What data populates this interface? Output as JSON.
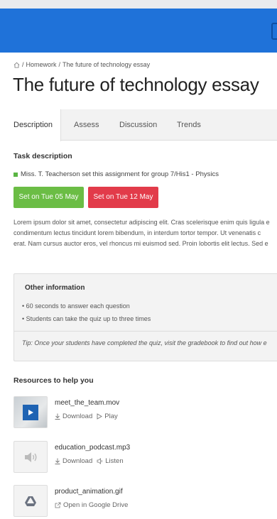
{
  "breadcrumb": {
    "separator": "/",
    "items": [
      "Homework",
      "The future of technology essay"
    ]
  },
  "page": {
    "title": "The future of technology essay"
  },
  "tabs": [
    {
      "label": "Description",
      "active": true
    },
    {
      "label": "Assess",
      "active": false
    },
    {
      "label": "Discussion",
      "active": false
    },
    {
      "label": "Trends",
      "active": false
    }
  ],
  "task": {
    "heading": "Task description",
    "assigned_text": "Miss. T. Teacherson set this assignment for group 7/His1 - Physics",
    "set_label": "Set on Tue 05 May",
    "due_label": "Set on Tue 12 May",
    "set_color": "#6bbd45",
    "due_color": "#e23b4a",
    "body_lines": [
      "Lorem ipsum dolor sit amet, consectetur adipiscing elit. Cras scelerisque enim quis ligula e",
      "condimentum lectus tincidunt lorem bibendum, in interdum tortor tempor. Ut venenatis c",
      "erat. Nam cursus auctor eros, vel rhoncus mi euismod sed. Proin lobortis elit lectus. Sed e"
    ]
  },
  "other_info": {
    "heading": "Other information",
    "items": [
      "• 60 seconds to answer each question",
      "• Students can take the quiz up to three times"
    ],
    "tip": "Tip: Once your students have completed the quiz, visit the gradebook to find out how e"
  },
  "resources": {
    "heading": "Resources to help you",
    "items": [
      {
        "name": "meet_the_team.mov",
        "icon": "play-icon",
        "actions": [
          "Download",
          "Play"
        ]
      },
      {
        "name": "education_podcast.mp3",
        "icon": "speaker-icon",
        "actions": [
          "Download",
          "Listen"
        ]
      },
      {
        "name": "product_animation.gif",
        "icon": "google-drive-icon",
        "actions": [
          "Open in Google Drive"
        ]
      }
    ]
  },
  "colors": {
    "header_bar": "#1f72d9",
    "accent_blue": "#1e63b3"
  }
}
